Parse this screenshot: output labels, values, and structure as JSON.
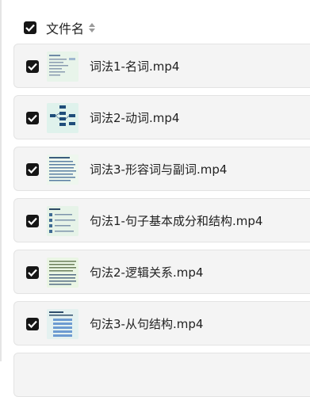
{
  "header": {
    "column_label": "文件名",
    "select_all_icon": "checkbox-checked-icon",
    "sort_icon": "sort-icon"
  },
  "files": [
    {
      "name": "词法1-名词.mp4",
      "thumb": "video-thumbnail",
      "checked": true
    },
    {
      "name": "词法2-动词.mp4",
      "thumb": "video-thumbnail",
      "checked": true
    },
    {
      "name": "词法3-形容词与副词.mp4",
      "thumb": "video-thumbnail",
      "checked": true
    },
    {
      "name": "句法1-句子基本成分和结构.mp4",
      "thumb": "video-thumbnail",
      "checked": true
    },
    {
      "name": "句法2-逻辑关系.mp4",
      "thumb": "video-thumbnail",
      "checked": true
    },
    {
      "name": "句法3-从句结构.mp4",
      "thumb": "video-thumbnail",
      "checked": true
    }
  ],
  "colors": {
    "checkbox": "#161616",
    "row_bg": "#f4f4f4",
    "row_border": "#e3e3e3",
    "thumb_bg": "#e9f6ea"
  }
}
